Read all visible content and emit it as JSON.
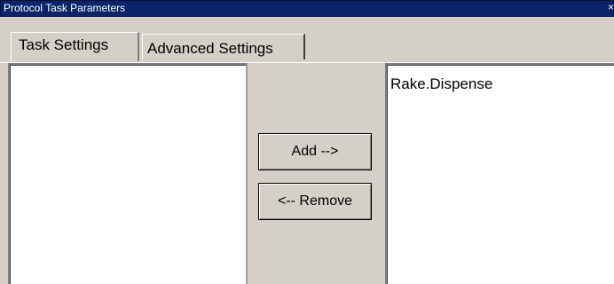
{
  "window": {
    "title": "Protocol Task Parameters",
    "close_glyph": "×"
  },
  "tabs": [
    {
      "label": "Task Settings",
      "active": true
    },
    {
      "label": "Advanced Settings",
      "active": false
    }
  ],
  "available_list": {
    "items": []
  },
  "selected_list": {
    "items": [
      "Rake.Dispense"
    ]
  },
  "buttons": {
    "add_label": "Add -->",
    "remove_label": "<-- Remove"
  }
}
